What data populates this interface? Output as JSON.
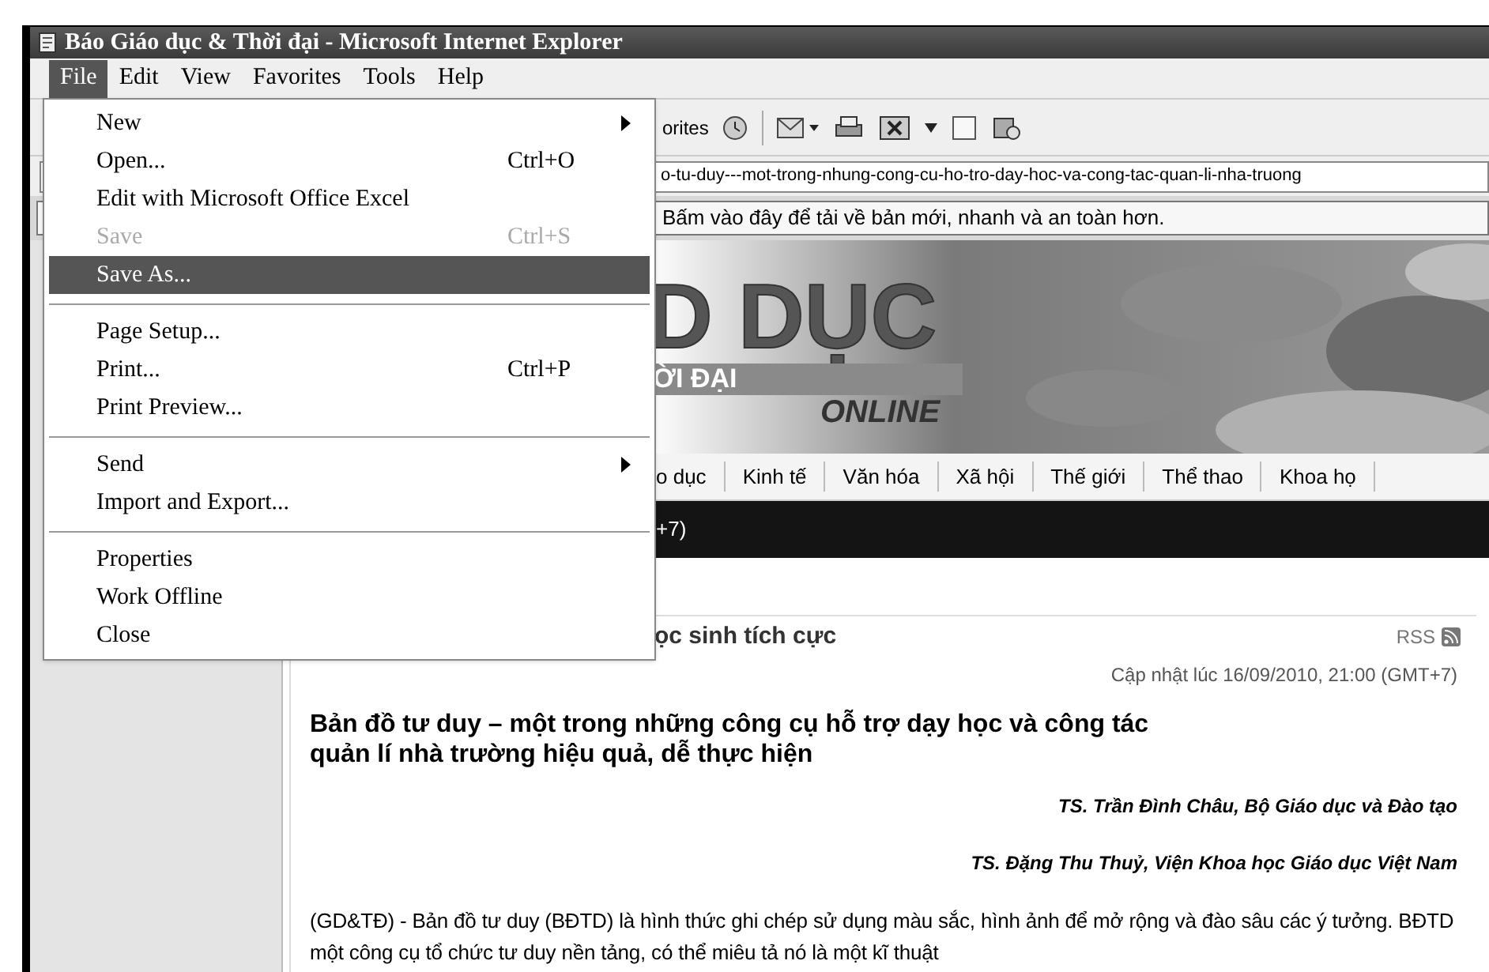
{
  "window": {
    "title": "Báo Giáo dục & Thời đại - Microsoft Internet Explorer"
  },
  "menu_bar": [
    {
      "label": "File",
      "selected": true
    },
    {
      "label": "Edit",
      "selected": false
    },
    {
      "label": "View",
      "selected": false
    },
    {
      "label": "Favorites",
      "selected": false
    },
    {
      "label": "Tools",
      "selected": false
    },
    {
      "label": "Help",
      "selected": false
    }
  ],
  "toolbar": {
    "favorites_label": "orites"
  },
  "address_bar": {
    "value": "o-tu-duy---mot-trong-nhung-cong-cu-ho-tro-day-hoc-va-cong-tac-quan-li-nha-truong"
  },
  "info_bar": {
    "text": "Bấm vào đây để tải về bản mới, nhanh và an toàn hơn."
  },
  "file_menu": [
    {
      "kind": "item",
      "label": "New",
      "submenu": true,
      "disabled": false,
      "selected": false
    },
    {
      "kind": "item",
      "label": "Open...",
      "shortcut": "Ctrl+O",
      "submenu": false,
      "disabled": false,
      "selected": false
    },
    {
      "kind": "item",
      "label": "Edit with Microsoft Office Excel",
      "submenu": false,
      "disabled": false,
      "selected": false
    },
    {
      "kind": "item",
      "label": "Save",
      "shortcut": "Ctrl+S",
      "submenu": false,
      "disabled": true,
      "selected": false
    },
    {
      "kind": "item",
      "label": "Save As...",
      "submenu": false,
      "disabled": false,
      "selected": true
    },
    {
      "kind": "separator"
    },
    {
      "kind": "item",
      "label": "Page Setup...",
      "submenu": false,
      "disabled": false,
      "selected": false
    },
    {
      "kind": "item",
      "label": "Print...",
      "shortcut": "Ctrl+P",
      "submenu": false,
      "disabled": false,
      "selected": false
    },
    {
      "kind": "item",
      "label": "Print Preview...",
      "submenu": false,
      "disabled": false,
      "selected": false
    },
    {
      "kind": "separator"
    },
    {
      "kind": "item",
      "label": "Send",
      "submenu": true,
      "disabled": false,
      "selected": false
    },
    {
      "kind": "item",
      "label": "Import and Export...",
      "submenu": false,
      "disabled": false,
      "selected": false
    },
    {
      "kind": "separator"
    },
    {
      "kind": "item",
      "label": "Properties",
      "submenu": false,
      "disabled": false,
      "selected": false
    },
    {
      "kind": "item",
      "label": "Work Offline",
      "submenu": false,
      "disabled": false,
      "selected": false
    },
    {
      "kind": "item",
      "label": "Close",
      "submenu": false,
      "disabled": false,
      "selected": false
    }
  ],
  "banner": {
    "title": "D DỤC",
    "subtitle": "ỜI ĐẠI",
    "tagline": "ONLINE"
  },
  "nav": [
    "o dục",
    "Kinh tế",
    "Văn hóa",
    "Xã hội",
    "Thế giới",
    "Thể thao",
    "Khoa họ"
  ],
  "black_bar": {
    "text": "+7)"
  },
  "article": {
    "section": "ọc sinh tích cực",
    "rss": "RSS",
    "updated": "Cập nhật lúc 16/09/2010, 21:00 (GMT+7)",
    "title": "Bản đồ tư duy – một trong những công cụ hỗ trợ dạy học và công tác quản lí nhà trường hiệu quả, dễ thực hiện",
    "authors": [
      "TS. Trần Đình Châu, Bộ Giáo dục và Đào tạo",
      "TS. Đặng Thu Thuỷ, Viện Khoa học Giáo dục Việt Nam"
    ],
    "body": "(GD&TĐ) - Bản đồ tư duy (BĐTD) là hình thức ghi chép sử dụng màu sắc, hình ảnh để mở rộng và đào sâu các ý tưởng. BĐTD một công cụ tổ chức tư duy nền tảng, có thể miêu tả nó là một kĩ thuật"
  }
}
